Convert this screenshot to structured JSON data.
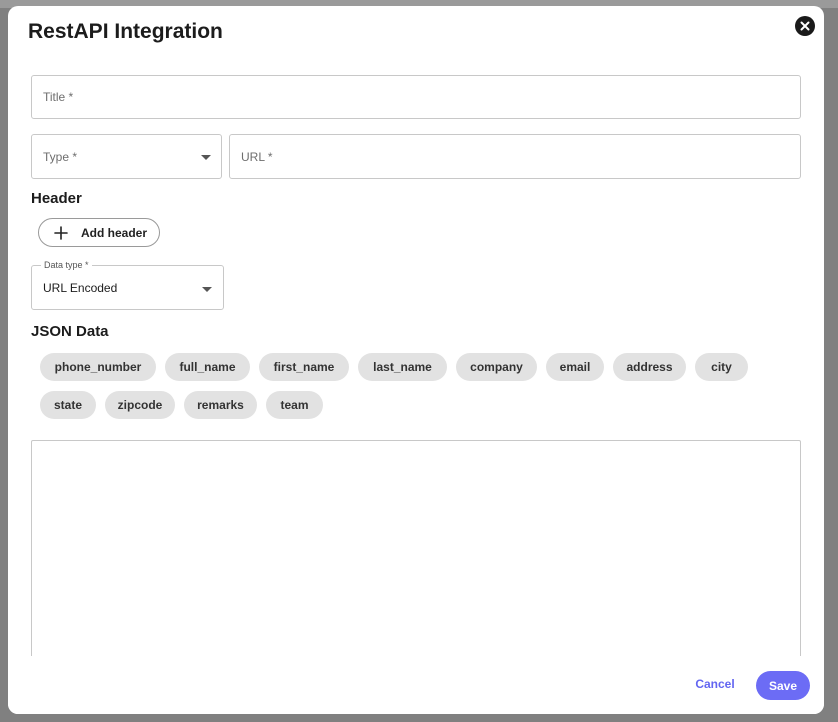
{
  "dialog": {
    "title": "RestAPI Integration"
  },
  "form": {
    "title_placeholder": "Title *",
    "type_placeholder": "Type *",
    "url_placeholder": "URL *",
    "header_section": "Header",
    "add_header_label": "Add header",
    "data_type_label": "Data type *",
    "data_type_value": "URL Encoded",
    "json_section": "JSON Data",
    "json_value": ""
  },
  "chips": [
    "phone_number",
    "full_name",
    "first_name",
    "last_name",
    "company",
    "email",
    "address",
    "city",
    "state",
    "zipcode",
    "remarks",
    "team"
  ],
  "footer": {
    "cancel_label": "Cancel",
    "save_label": "Save"
  },
  "colors": {
    "accent": "#6c6cf5",
    "chip_bg": "#e2e2e2"
  },
  "icons": {
    "close": "close-circle-icon",
    "add": "plus-icon",
    "dropdown": "caret-down-icon"
  }
}
